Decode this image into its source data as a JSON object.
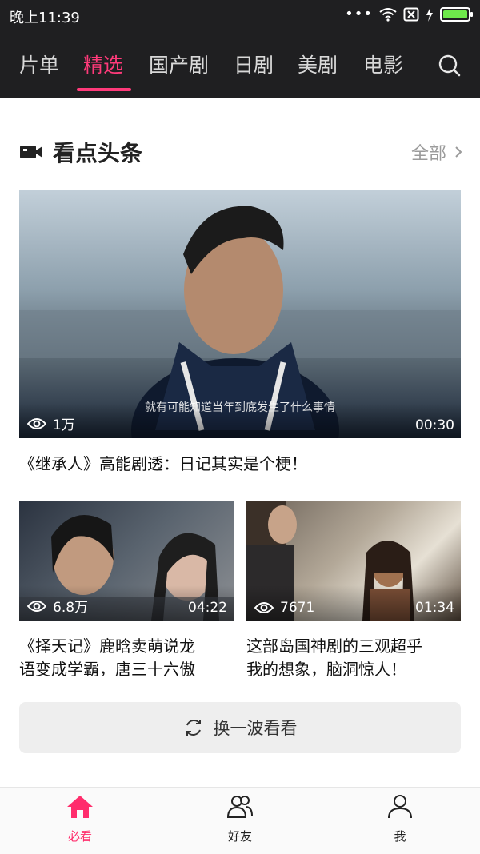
{
  "status_bar": {
    "time": "晚上11:39",
    "dots": "•••",
    "battery_color": "#6ee84b"
  },
  "top_nav": {
    "tabs": [
      {
        "label": "片单"
      },
      {
        "label": "精选",
        "active": true
      },
      {
        "label": "国产剧"
      },
      {
        "label": "日剧"
      },
      {
        "label": "美剧"
      },
      {
        "label": "电影"
      }
    ],
    "accent_color": "#ff3a7a"
  },
  "section": {
    "title": "看点头条",
    "see_all": "全部"
  },
  "featured": {
    "subtitle": "就有可能知道当年到底发生了什么事情",
    "views": "1万",
    "duration": "00:30",
    "caption": "《继承人》高能剧透：日记其实是个梗！"
  },
  "cards": [
    {
      "views": "6.8万",
      "duration": "04:22",
      "caption_line1": "《择天记》鹿晗卖萌说龙",
      "caption_line2": "语变成学霸，唐三十六傲"
    },
    {
      "views": "7671",
      "duration": "01:34",
      "caption_line1": "这部岛国神剧的三观超乎",
      "caption_line2": "我的想象，脑洞惊人！"
    }
  ],
  "refresh_label": "换一波看看",
  "bottom_nav": [
    {
      "label": "必看",
      "icon": "home-icon",
      "active": true
    },
    {
      "label": "好友",
      "icon": "friends-icon"
    },
    {
      "label": "我",
      "icon": "profile-icon"
    }
  ]
}
